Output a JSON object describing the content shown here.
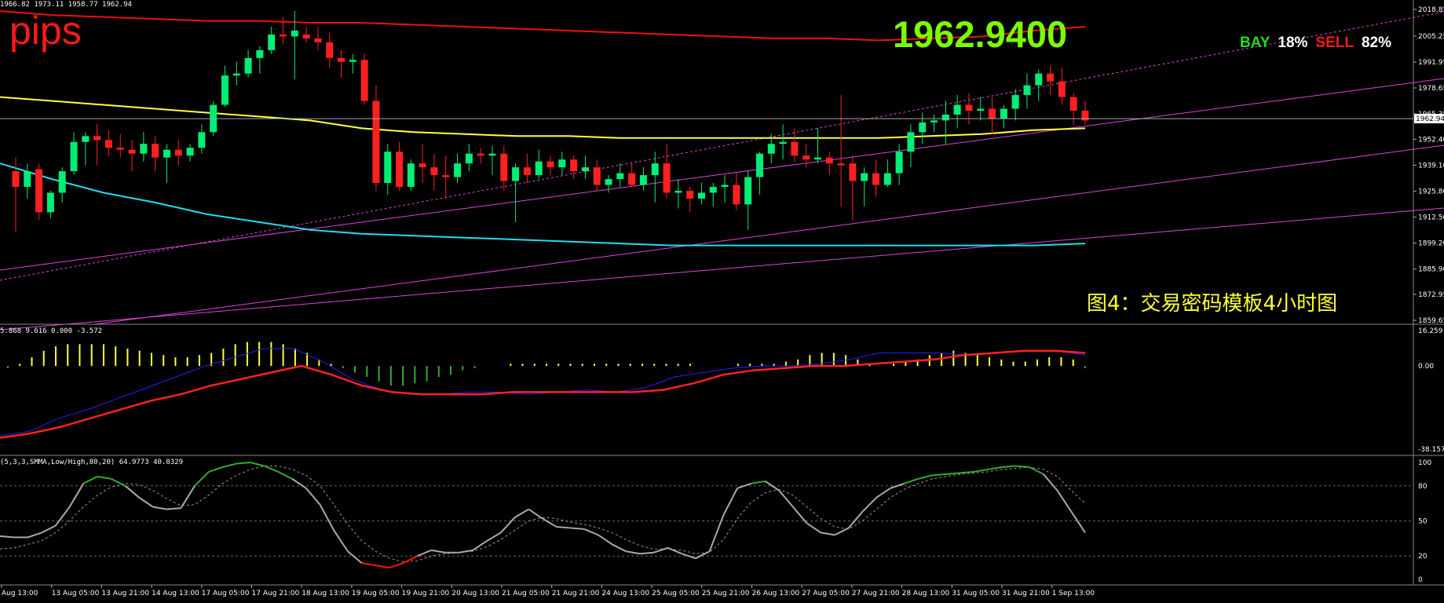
{
  "header": {
    "ohlc": "1966.82 1973.11 1958.77 1962.94",
    "pips_label": "pips",
    "big_price": "1962.9400",
    "sentiment": {
      "buy_label": "BAY",
      "buy_pct": "18%",
      "sell_label": "SELL",
      "sell_pct": "82%"
    },
    "caption": "图4：交易密码模板4小时图"
  },
  "colors": {
    "bull": "#00ee76",
    "bear": "#ff2020",
    "ma_red": "#ee1111",
    "ma_yellow": "#ffff44",
    "ma_cyan": "#22ddee",
    "channel": "#dd44dd",
    "macd_signal": "#ff2222",
    "macd_main": "#2222ff",
    "stoch": "#aaaaaa",
    "stoch_high": "#33aa33",
    "stoch_low": "#ff1111"
  },
  "chart_data": [
    {
      "type": "candlestick",
      "title": "",
      "ylim": [
        1859.65,
        2018.85
      ],
      "price_ticks": [
        "2018.85",
        "2005.25",
        "1991.95",
        "1978.65",
        "1965.35",
        "1952.40",
        "1939.10",
        "1925.80",
        "1912.50",
        "1899.20",
        "1885.90",
        "1872.95",
        "1859.65"
      ],
      "current_price": "1962.94",
      "candles": [
        [
          1936,
          1943,
          1905,
          1928
        ],
        [
          1928,
          1940,
          1922,
          1936
        ],
        [
          1937,
          1940,
          1911,
          1915
        ],
        [
          1915,
          1926,
          1912,
          1925
        ],
        [
          1925,
          1938,
          1920,
          1936
        ],
        [
          1936,
          1956,
          1934,
          1951
        ],
        [
          1951,
          1956,
          1939,
          1954
        ],
        [
          1954,
          1960,
          1939,
          1952
        ],
        [
          1952,
          1957,
          1944,
          1948
        ],
        [
          1948,
          1955,
          1943,
          1947
        ],
        [
          1947,
          1952,
          1936,
          1945
        ],
        [
          1945,
          1956,
          1941,
          1950
        ],
        [
          1950,
          1954,
          1936,
          1943
        ],
        [
          1943,
          1950,
          1930,
          1947
        ],
        [
          1947,
          1952,
          1939,
          1944
        ],
        [
          1944,
          1950,
          1941,
          1948
        ],
        [
          1948,
          1960,
          1945,
          1956
        ],
        [
          1956,
          1972,
          1954,
          1970
        ],
        [
          1970,
          1990,
          1969,
          1985
        ],
        [
          1985,
          1992,
          1980,
          1986
        ],
        [
          1986,
          1998,
          1984,
          1994
        ],
        [
          1994,
          2000,
          1986,
          1998
        ],
        [
          1998,
          2010,
          1996,
          2006
        ],
        [
          2006,
          2015,
          2001,
          2005
        ],
        [
          2005,
          2018,
          1983,
          2008
        ],
        [
          2006,
          2010,
          2002,
          2004
        ],
        [
          2004,
          2010,
          1998,
          2002
        ],
        [
          2002,
          2007,
          1989,
          1994
        ],
        [
          1994,
          1998,
          1984,
          1992
        ],
        [
          1992,
          1996,
          1986,
          1993
        ],
        [
          1993,
          1996,
          1970,
          1972
        ],
        [
          1972,
          1980,
          1926,
          1930
        ],
        [
          1930,
          1950,
          1924,
          1946
        ],
        [
          1946,
          1951,
          1926,
          1928
        ],
        [
          1928,
          1942,
          1926,
          1940
        ],
        [
          1940,
          1950,
          1930,
          1938
        ],
        [
          1938,
          1945,
          1926,
          1934
        ],
        [
          1934,
          1944,
          1922,
          1933
        ],
        [
          1933,
          1945,
          1930,
          1940
        ],
        [
          1940,
          1950,
          1936,
          1945
        ],
        [
          1945,
          1948,
          1940,
          1944
        ],
        [
          1944,
          1949,
          1934,
          1945
        ],
        [
          1945,
          1949,
          1926,
          1931
        ],
        [
          1931,
          1940,
          1910,
          1938
        ],
        [
          1938,
          1945,
          1930,
          1934
        ],
        [
          1934,
          1947,
          1932,
          1941
        ],
        [
          1941,
          1944,
          1934,
          1938
        ],
        [
          1938,
          1946,
          1934,
          1942
        ],
        [
          1942,
          1944,
          1932,
          1936
        ],
        [
          1936,
          1944,
          1932,
          1938
        ],
        [
          1938,
          1942,
          1926,
          1929
        ],
        [
          1929,
          1934,
          1925,
          1932
        ],
        [
          1932,
          1940,
          1928,
          1935
        ],
        [
          1935,
          1940,
          1928,
          1929
        ],
        [
          1929,
          1938,
          1926,
          1934
        ],
        [
          1934,
          1946,
          1920,
          1940
        ],
        [
          1940,
          1950,
          1922,
          1925
        ],
        [
          1925,
          1932,
          1917,
          1926
        ],
        [
          1926,
          1928,
          1915,
          1922
        ],
        [
          1922,
          1930,
          1919,
          1925
        ],
        [
          1925,
          1930,
          1918,
          1928
        ],
        [
          1928,
          1934,
          1920,
          1929
        ],
        [
          1929,
          1935,
          1916,
          1919
        ],
        [
          1919,
          1936,
          1906,
          1933
        ],
        [
          1933,
          1946,
          1924,
          1945
        ],
        [
          1945,
          1955,
          1940,
          1950
        ],
        [
          1950,
          1960,
          1942,
          1951
        ],
        [
          1951,
          1958,
          1941,
          1944
        ],
        [
          1944,
          1950,
          1938,
          1942
        ],
        [
          1942,
          1958,
          1940,
          1943
        ],
        [
          1943,
          1946,
          1934,
          1940
        ],
        [
          1940,
          1975,
          1918,
          1939
        ],
        [
          1940,
          1944,
          1911,
          1931
        ],
        [
          1931,
          1938,
          1918,
          1935
        ],
        [
          1935,
          1942,
          1923,
          1929
        ],
        [
          1929,
          1942,
          1928,
          1935
        ],
        [
          1935,
          1950,
          1929,
          1946
        ],
        [
          1946,
          1960,
          1938,
          1956
        ],
        [
          1956,
          1966,
          1950,
          1961
        ],
        [
          1961,
          1965,
          1956,
          1962
        ],
        [
          1962,
          1972,
          1950,
          1965
        ],
        [
          1965,
          1975,
          1958,
          1970
        ],
        [
          1970,
          1976,
          1960,
          1967
        ],
        [
          1967,
          1974,
          1962,
          1968
        ],
        [
          1968,
          1974,
          1955,
          1963
        ],
        [
          1963,
          1970,
          1958,
          1968
        ],
        [
          1968,
          1978,
          1962,
          1975
        ],
        [
          1975,
          1986,
          1968,
          1980
        ],
        [
          1980,
          1988,
          1972,
          1986
        ],
        [
          1986,
          1990,
          1975,
          1982
        ],
        [
          1982,
          1989,
          1970,
          1974
        ],
        [
          1974,
          1976,
          1960,
          1967
        ],
        [
          1967,
          1972,
          1960,
          1962
        ]
      ],
      "moving_averages": [
        {
          "color": "ma_red",
          "values": [
            2018,
            2016,
            2015,
            2014,
            2013,
            2013,
            2012,
            2012,
            2011,
            2010,
            2009,
            2008,
            2007,
            2006,
            2005,
            2004,
            2004,
            2003,
            2004,
            2005,
            2008,
            2010
          ]
        },
        {
          "color": "ma_yellow",
          "values": [
            1974,
            1972,
            1970,
            1968,
            1966,
            1964,
            1962,
            1958,
            1956,
            1955,
            1954,
            1954,
            1953,
            1953,
            1953,
            1953,
            1953,
            1953,
            1954,
            1955,
            1957,
            1958
          ]
        },
        {
          "color": "ma_cyan",
          "values": [
            1940,
            1932,
            1925,
            1920,
            1914,
            1910,
            1906,
            1904,
            1903,
            1902,
            1901,
            1900,
            1899,
            1898,
            1898,
            1898,
            1898,
            1898,
            1898,
            1898,
            1898,
            1899
          ]
        }
      ]
    },
    {
      "type": "bar",
      "name": "MACD",
      "params_label": "5.868 9.616 0.000 -3.572",
      "ylim": [
        -38.157,
        16.259
      ],
      "ticks": [
        "16.259",
        "0.00",
        "-38.157"
      ],
      "histogram": [
        -1,
        1,
        4,
        7,
        9,
        10,
        10,
        10,
        10,
        9,
        8,
        7,
        6,
        5,
        4,
        4,
        5,
        6,
        8,
        10,
        11,
        11,
        11,
        10,
        8,
        6,
        3,
        1,
        -1,
        -3,
        -5,
        -7,
        -9,
        -9,
        -8,
        -7,
        -5,
        -4,
        -2,
        -1,
        0,
        0,
        1,
        1,
        1,
        1,
        1,
        1,
        1,
        1,
        1,
        1,
        1,
        1,
        1,
        1,
        1,
        1,
        0,
        0,
        0,
        1,
        1,
        1,
        1,
        2,
        3,
        5,
        6,
        6,
        5,
        3,
        1,
        0,
        1,
        2,
        3,
        5,
        6,
        7,
        6,
        5,
        4,
        3,
        2,
        2,
        3,
        4,
        4,
        3,
        -1
      ],
      "signal": [
        -33,
        -31,
        -28,
        -24,
        -20,
        -16,
        -13,
        -9,
        -6,
        -3,
        0,
        -4,
        -9,
        -12,
        -13,
        -13,
        -13,
        -12,
        -12,
        -12,
        -12,
        -12,
        -11,
        -8,
        -4,
        -2,
        -1,
        0,
        0,
        1,
        2,
        3,
        5,
        6,
        7,
        7,
        6
      ],
      "main": [
        -32,
        -30,
        -24,
        -20,
        -15,
        -10,
        -5,
        0,
        4,
        8,
        8,
        2,
        -6,
        -11,
        -13,
        -13,
        -12,
        -12,
        -13,
        -12,
        -11,
        -12,
        -10,
        -5,
        -3,
        -1,
        0,
        0,
        1,
        3,
        6,
        6,
        6,
        5,
        6,
        7,
        7,
        5
      ]
    },
    {
      "type": "line",
      "name": "Stochastic",
      "params_label": "(5,3,3,SMMA,Low/High,80,20) 64.9773 40.0329",
      "ylim": [
        0,
        100
      ],
      "ticks": [
        "100",
        "80",
        "50",
        "20",
        "0"
      ],
      "main": [
        37,
        36,
        36,
        40,
        46,
        62,
        82,
        88,
        86,
        80,
        70,
        62,
        60,
        61,
        80,
        92,
        96,
        99,
        100,
        97,
        92,
        86,
        78,
        64,
        42,
        24,
        14,
        12,
        10,
        14,
        20,
        25,
        23,
        23,
        25,
        33,
        40,
        53,
        60,
        52,
        45,
        44,
        43,
        38,
        30,
        24,
        22,
        23,
        27,
        22,
        18,
        24,
        55,
        78,
        82,
        84,
        76,
        62,
        48,
        40,
        38,
        44,
        58,
        70,
        78,
        82,
        86,
        89,
        90,
        91,
        92,
        94,
        96,
        97,
        96,
        90,
        76,
        58,
        40
      ],
      "signal": [
        26,
        27,
        30,
        33,
        40,
        50,
        62,
        72,
        79,
        82,
        81,
        76,
        69,
        63,
        64,
        72,
        82,
        89,
        94,
        97,
        97,
        94,
        89,
        80,
        64,
        47,
        33,
        24,
        18,
        15,
        16,
        20,
        22,
        23,
        24,
        28,
        34,
        42,
        50,
        53,
        52,
        49,
        47,
        44,
        40,
        34,
        29,
        26,
        26,
        25,
        22,
        23,
        34,
        52,
        66,
        74,
        77,
        72,
        62,
        52,
        45,
        43,
        50,
        60,
        70,
        77,
        82,
        86,
        88,
        90,
        91,
        92,
        94,
        95,
        96,
        94,
        88,
        76,
        65
      ]
    }
  ],
  "time_axis": [
    "Aug 13:00",
    "13 Aug 05:00",
    "13 Aug 21:00",
    "14 Aug 13:00",
    "17 Aug 05:00",
    "17 Aug 21:00",
    "18 Aug 13:00",
    "19 Aug 05:00",
    "19 Aug 21:00",
    "20 Aug 13:00",
    "21 Aug 05:00",
    "21 Aug 21:00",
    "24 Aug 13:00",
    "25 Aug 05:00",
    "25 Aug 21:00",
    "26 Aug 13:00",
    "27 Aug 05:00",
    "27 Aug 21:00",
    "28 Aug 13:00",
    "31 Aug 05:00",
    "31 Aug 21:00",
    "1 Sep 13:00"
  ]
}
